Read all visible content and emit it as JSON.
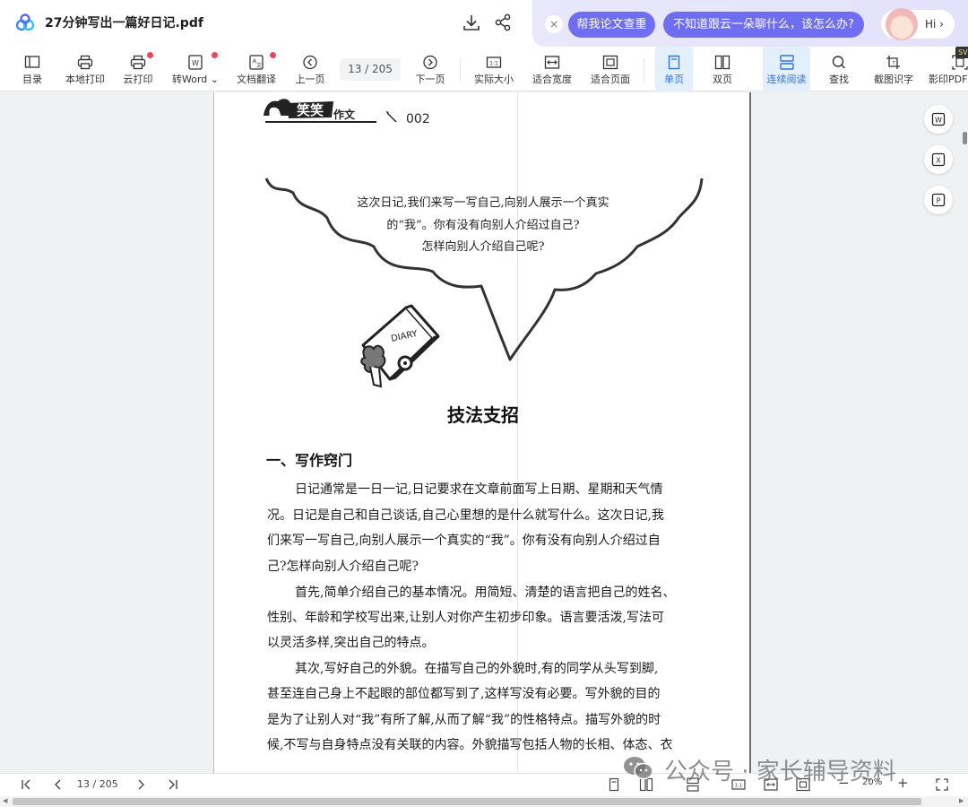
{
  "titlebar": {
    "title": "27分钟写出一篇好日记.pdf",
    "pill_check": "帮我论文查重",
    "pill_chat": "不知道跟云一朵聊什么，该怎么办?",
    "hi": "Hi ›",
    "close": "×"
  },
  "toolbar": {
    "toc": "目录",
    "local_print": "本地打印",
    "cloud_print": "云打印",
    "to_word": "转Word ⌄",
    "translate": "文档翻译",
    "prev": "上一页",
    "page_indicator": "13 / 205",
    "next": "下一页",
    "actual_size": "实际大小",
    "fit_width": "适合宽度",
    "fit_page": "适合页面",
    "single_page": "单页",
    "double_page": "双页",
    "continuous": "连续阅读",
    "find": "查找",
    "ocr": "截图识字",
    "scan_pdf": "影印PDF",
    "svip": "SV"
  },
  "page": {
    "book_series": "笑笑",
    "book_series_suffix": "作文",
    "page_number": "002",
    "bubble_lines": [
      "这次日记,我们来写一写自己,向别人展示一个真实",
      "的“我”。你有没有向别人介绍过自己?",
      "怎样向别人介绍自己呢?"
    ],
    "diary_label": "DIARY",
    "heading": "技法支招",
    "subheading": "一、写作窍门",
    "body_lines": [
      "日记通常是一日一记,日记要求在文章前面写上日期、星期和天气情",
      "况。日记是自己和自己谈话,自己心里想的是什么就写什么。这次日记,我",
      "们来写一写自己,向别人展示一个真实的“我”。你有没有向别人介绍过自",
      "己?怎样向别人介绍自己呢?",
      "首先,简单介绍自己的基本情况。用简短、清楚的语言把自己的姓名、",
      "性别、年龄和学校写出来,让别人对你产生初步印象。语言要活泼,写法可",
      "以灵活多样,突出自己的特点。",
      "其次,写好自己的外貌。在描写自己的外貌时,有的同学从头写到脚,",
      "甚至连自己身上不起眼的部位都写到了,这样写没有必要。写外貌的目的",
      "是为了让别人对“我”有所了解,从而了解“我”的性格特点。描写外貌的时",
      "候,不写与自身特点没有关联的内容。外貌描写包括人物的长相、体态、衣"
    ]
  },
  "bottombar": {
    "page_indicator": "13 / 205",
    "zoom": "20%",
    "zoom_minus": "−",
    "zoom_plus": "+"
  },
  "watermark": {
    "text": "公众号 · 家长辅导资料"
  },
  "colors": {
    "accent": "#6f6ef0",
    "active_tool_bg": "#e3effd",
    "active_tool_fg": "#2f74e0",
    "badge_red": "#f0445a"
  }
}
